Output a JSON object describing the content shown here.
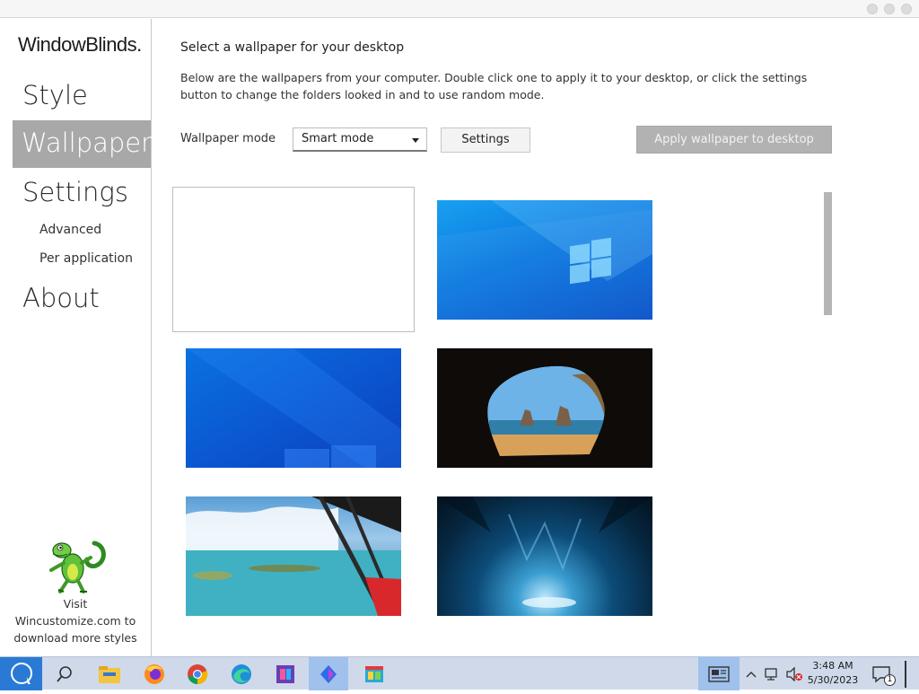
{
  "app": {
    "logo_text": "WindowBlinds",
    "logo_mark": "."
  },
  "sidebar": {
    "nav": [
      {
        "label": "Style"
      },
      {
        "label": "Wallpaper"
      },
      {
        "label": "Settings"
      },
      {
        "label": "About"
      }
    ],
    "sub_items": [
      {
        "label": "Advanced"
      },
      {
        "label": "Per application"
      }
    ],
    "promo": {
      "line1": "Visit",
      "line2": "Wincustomize.com to",
      "line3": "download more styles"
    }
  },
  "main": {
    "heading": "Select a wallpaper for your desktop",
    "description": "Below are the wallpapers from your computer.  Double click one to apply it to your desktop, or click the settings button to change the folders looked in and to use random mode.",
    "mode_label": "Wallpaper mode",
    "mode_value": "Smart mode",
    "settings_button": "Settings",
    "apply_button": "Apply wallpaper to desktop"
  },
  "taskbar": {
    "time": "3:48 AM",
    "date": "5/30/2023",
    "notification_count": "1",
    "icons": [
      "start-icon",
      "search-icon",
      "file-explorer-icon",
      "firefox-icon",
      "chrome-icon",
      "edge-icon",
      "app-icon",
      "copilot-icon",
      "windowblinds-icon"
    ]
  },
  "colors": {
    "selected_nav": "#a8a8a8",
    "taskbar": "#cfd9ea",
    "apply_disabled": "#b2b2b2"
  }
}
